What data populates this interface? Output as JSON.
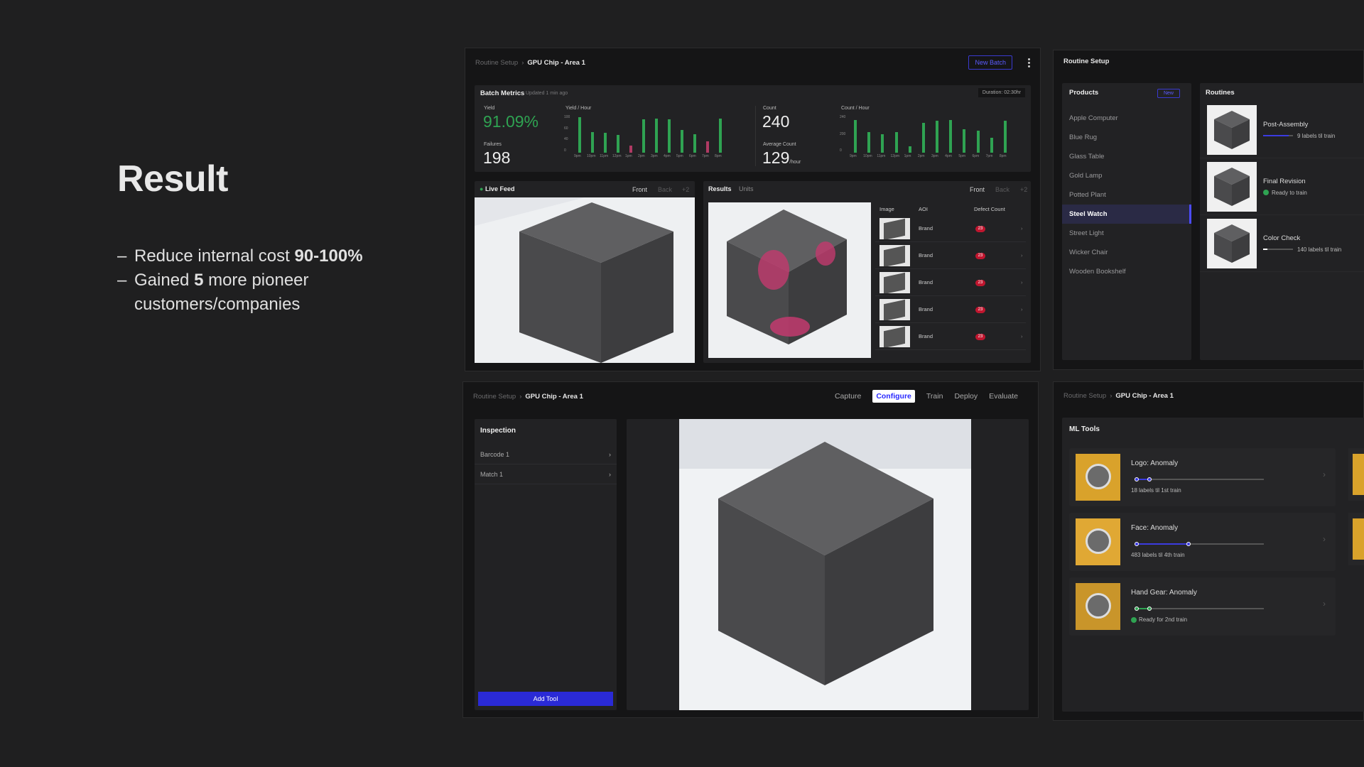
{
  "slide": {
    "title": "Result",
    "bullets": [
      {
        "pre": "Reduce internal cost ",
        "bold": "90-100%",
        "post": ""
      },
      {
        "pre": "Gained ",
        "bold": "5",
        "post": " more pioneer customers/companies"
      }
    ]
  },
  "colors": {
    "accent": "#3b3be0",
    "good": "#2fa352",
    "bad": "#c0162f",
    "failbar": "#b03a63"
  },
  "dashboard": {
    "breadcrumb": {
      "parent": "Routine Setup",
      "current": "GPU Chip - Area 1"
    },
    "new_batch": "New Batch",
    "metrics": {
      "title": "Batch Metrics",
      "updated": "Updated 1 min ago",
      "duration": "Duration: 02:30hr",
      "yield_label": "Yield",
      "yield_value": "91.09%",
      "failures_label": "Failures",
      "failures_value": "198",
      "yield_hour_label": "Yield / Hour",
      "count_label": "Count",
      "count_value": "240",
      "avg_label": "Average Count",
      "avg_value": "129",
      "avg_unit": "/hour",
      "count_hour_label": "Count / Hour"
    },
    "live_feed": {
      "title": "Live Feed",
      "front": "Front",
      "back": "Back",
      "more": "+2"
    },
    "results": {
      "tab_results": "Results",
      "tab_units": "Units",
      "front": "Front",
      "back": "Back",
      "more": "+2",
      "headers": [
        "Image",
        "AOI",
        "Defect Count"
      ],
      "rows": [
        {
          "aoi": "Brand",
          "count": "23"
        },
        {
          "aoi": "Brand",
          "count": "23"
        },
        {
          "aoi": "Brand",
          "count": "23"
        },
        {
          "aoi": "Brand",
          "count": "23"
        },
        {
          "aoi": "Brand",
          "count": "23"
        }
      ]
    }
  },
  "chart_data": [
    {
      "type": "bar",
      "title": "Yield / Hour",
      "ylim": [
        0,
        100
      ],
      "y_ticks": [
        "100",
        "60",
        "40",
        "0"
      ],
      "x": [
        "9pm",
        "10pm",
        "11pm",
        "12pm",
        "1pm",
        "2pm",
        "3pm",
        "4pm",
        "5pm",
        "6pm",
        "7pm",
        "8pm"
      ],
      "values": [
        95,
        55,
        52,
        48,
        18,
        88,
        90,
        88,
        60,
        50,
        30,
        90
      ],
      "colors": [
        "good",
        "good",
        "good",
        "good",
        "bad",
        "good",
        "good",
        "good",
        "good",
        "good",
        "bad",
        "good"
      ]
    },
    {
      "type": "bar",
      "title": "Count / Hour",
      "ylim": [
        0,
        240
      ],
      "y_ticks": [
        "240",
        "200",
        "0"
      ],
      "x": [
        "9pm",
        "10pm",
        "11pm",
        "12pm",
        "1pm",
        "2pm",
        "3pm",
        "4pm",
        "5pm",
        "6pm",
        "7pm",
        "8pm"
      ],
      "values": [
        210,
        130,
        120,
        130,
        40,
        190,
        205,
        210,
        150,
        140,
        95,
        205
      ],
      "colors": [
        "good",
        "good",
        "good",
        "good",
        "good",
        "good",
        "good",
        "good",
        "good",
        "good",
        "good",
        "good"
      ]
    }
  ],
  "routine_setup": {
    "title": "Routine Setup",
    "products_title": "Products",
    "new_label": "New",
    "products": [
      "Apple Computer",
      "Blue Rug",
      "Glass Table",
      "Gold Lamp",
      "Potted Plant",
      "Steel Watch",
      "Street Light",
      "Wicker Chair",
      "Wooden Bookshelf"
    ],
    "selected_product": "Steel Watch",
    "routines_title": "Routines",
    "routines": [
      {
        "name": "Post-Assembly",
        "status": "9 labels til train",
        "progress": 0.85,
        "ready": false
      },
      {
        "name": "Final Revision",
        "status": "Ready to train",
        "progress": 1,
        "ready": true
      },
      {
        "name": "Color Check",
        "status": "140 labels til train",
        "progress": 0.15,
        "ready": false
      }
    ]
  },
  "configure": {
    "breadcrumb": {
      "parent": "Routine Setup",
      "current": "GPU Chip - Area 1"
    },
    "tabs": [
      "Capture",
      "Configure",
      "Train",
      "Deploy",
      "Evaluate"
    ],
    "active_tab": "Configure",
    "inspection_title": "Inspection",
    "tools": [
      "Barcode 1",
      "Match 1"
    ],
    "add_tool": "Add Tool"
  },
  "ml_tools": {
    "breadcrumb": {
      "parent": "Routine Setup",
      "current": "GPU Chip - Area 1"
    },
    "title": "ML Tools",
    "tools": [
      {
        "name": "Logo: Anomaly",
        "status": "18 labels til 1st train",
        "progress": 0.12,
        "ready": false
      },
      {
        "name": "Face: Anomaly",
        "status": "483 labels til 4th train",
        "progress": 0.42,
        "ready": false
      },
      {
        "name": "Hand Gear: Anomaly",
        "status": "Ready for 2nd train",
        "progress": 0.12,
        "ready": true
      }
    ]
  }
}
